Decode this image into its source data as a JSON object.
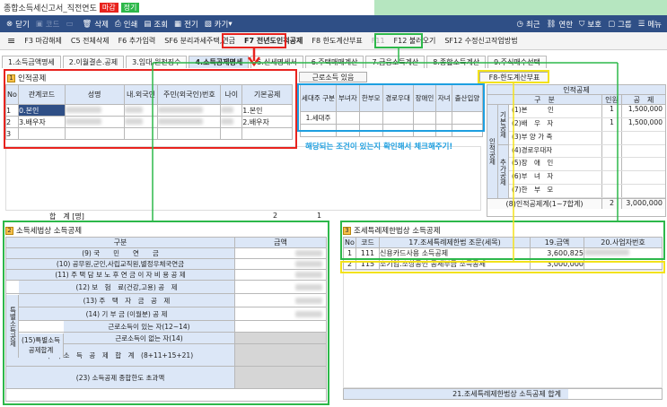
{
  "window": {
    "title": "종합소득세신고서_직전연도",
    "badge_closing": "마감",
    "badge_regular": "정기"
  },
  "toolbar": {
    "close": "닫기",
    "code": "코드",
    "delete": "삭제",
    "print": "인쇄",
    "view": "조회",
    "electronic": "전기",
    "card": "카기",
    "recent": "최근",
    "link": "연한",
    "protect": "보호",
    "group": "그룹",
    "menu": "메뉴"
  },
  "fkeys": [
    "F3 마감해제",
    "C5 전체삭제",
    "F6 추가입력",
    "SF6 분리과세주택,연금",
    "F7 전년도인적공제",
    "F8 한도계산부표",
    "F11",
    "F12 불러오기",
    "SF12 수정신고작업방법"
  ],
  "tabs": [
    "1.소득금액명세",
    "2.이월결손.공제",
    "3.임대.원천징수",
    "4.소득공제명세",
    "5.신세명세서",
    "6.주택매매계산",
    "7.금융소득계산",
    "8.종합소득계산",
    "9.주식매수선택"
  ],
  "person": {
    "heading": "인적공제",
    "cols": [
      "No",
      "관계코드",
      "성명",
      "내.외국인",
      "주민(외국인)번호",
      "나이",
      "기본공제"
    ],
    "rows": [
      {
        "no": "1",
        "rel": "0.본인",
        "basic": "1.본인"
      },
      {
        "no": "2",
        "rel": "3.배우자",
        "basic": "2.배우자"
      },
      {
        "no": "3",
        "rel": "",
        "basic": ""
      }
    ],
    "total_label": "합　계 [명]",
    "total_count": "2",
    "total_basic": "1"
  },
  "conditions": {
    "button": "근로소득 있음",
    "cols": [
      "세대주 구분",
      "부녀자",
      "한부모",
      "경로우대",
      "장애인",
      "자녀",
      "출산입양"
    ],
    "row1": "1.세대주"
  },
  "note": "해당되는 조건이 있는지 확인해서 체크해주기!",
  "limit_button": "F8-한도계산부표",
  "deduction": {
    "title": "인적공제",
    "group_label": "구　분",
    "col_person": "인원",
    "col_amount": "공　제",
    "group_basic": "기본공제",
    "group_extra": "추가공제",
    "side_label": "인적공제",
    "rows": [
      {
        "label": "(1)본　　　인",
        "count": "1",
        "amount": "1,500,000"
      },
      {
        "label": "(2)배　우　자",
        "count": "1",
        "amount": "1,500,000"
      },
      {
        "label": "(3)부 양 가 족",
        "count": "",
        "amount": ""
      },
      {
        "label": "(4)경로우대자",
        "count": "",
        "amount": ""
      },
      {
        "label": "(5)장　애　인",
        "count": "",
        "amount": ""
      },
      {
        "label": "(6)부　녀　자",
        "count": "",
        "amount": ""
      },
      {
        "label": "(7)한　부　모",
        "count": "",
        "amount": ""
      }
    ],
    "total_label": "(8)인적공제계(1~7합계)",
    "total_count": "2",
    "total_amount": "3,000,000"
  },
  "section2": {
    "num": "2",
    "title": "소득세법상 소득공제",
    "col_item": "구분",
    "col_amount": "금액",
    "side_label": "특별소득공제",
    "sub_label": "(15)특별소득공제합계",
    "rows": [
      "(9) 국　　민　　연　　금",
      "(10) 공무원,군인,사립교직원,별정우체국연금",
      "(11) 주 택 담 보 노 후 연 금 이 자 비 용 공 제",
      "(12) 보　험　료(건강,고용) 공　제",
      "(13) 주　택　자　금　공　제",
      "(14) 기 부 금 (이월분) 공 제",
      "근로소득이 있는 자(12~14)",
      "근로소득이 없는 자(14)",
      "(22) 소　득　공　제　합　계　(8+11+15+21)",
      "(23) 소득공제 종합한도 초과액"
    ]
  },
  "section3": {
    "num": "3",
    "title": "조세특례제한법상 소득공제",
    "cols": [
      "No",
      "코드",
      "17.조세특례제한법 조문(세목)",
      "19.금액",
      "20.사업자번호"
    ],
    "rows": [
      {
        "no": "1",
        "code": "111",
        "name": "신용카드사용 소득공제",
        "amount": "3,600,825"
      },
      {
        "no": "2",
        "code": "115",
        "name": "소기업.소상공인 공제부금 소득공제",
        "amount": "3,000,000"
      }
    ],
    "total_label": "21.조세특례제한법상 소득공제 합계"
  },
  "colors": {
    "toolbar": "#2f4f86",
    "red": "#e8231e",
    "green": "#2db84a",
    "yellow": "#f3e21b",
    "blue": "#1d9fe0",
    "header_blue": "#dce7f7"
  }
}
